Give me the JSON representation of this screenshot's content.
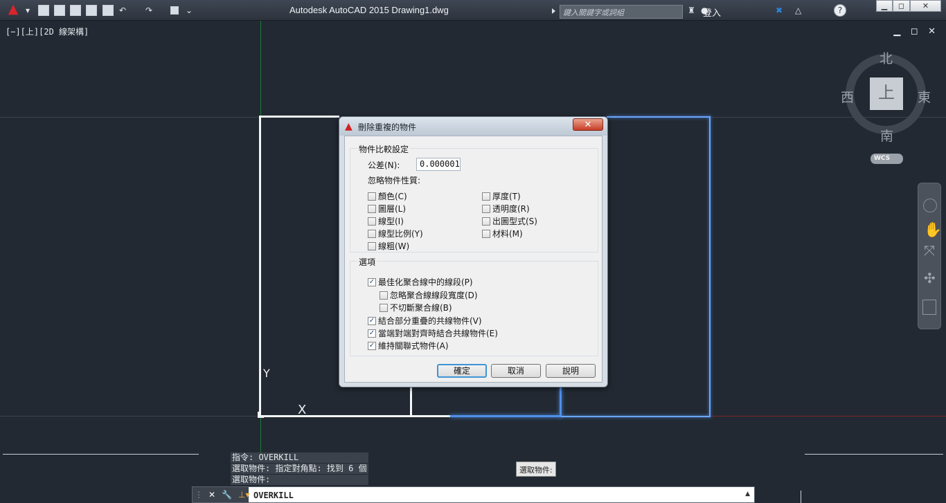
{
  "app": {
    "title": "Autodesk AutoCAD 2015    Drawing1.dwg",
    "search_placeholder": "鍵入關鍵字或詞組",
    "signin_label": "登入"
  },
  "viewport": {
    "label": "[−][上][2D 線架構]",
    "window_controls": "▁ ◻ ✕"
  },
  "viewcube": {
    "face_label": "上",
    "north": "北",
    "south": "南",
    "east": "東",
    "west": "西",
    "coordinate_system": "WCS"
  },
  "axes": {
    "y_label": "Y",
    "x_label": "X"
  },
  "dialog": {
    "title": "刪除重複的物件",
    "close_symbol": "✕",
    "comparison_group": "物件比較設定",
    "tolerance_label": "公差(N):",
    "tolerance_value": "0.000001",
    "ignore_label": "忽略物件性質:",
    "ignore_options": [
      {
        "label": "顏色(C)",
        "checked": false
      },
      {
        "label": "圖層(L)",
        "checked": false
      },
      {
        "label": "線型(I)",
        "checked": false
      },
      {
        "label": "線型比例(Y)",
        "checked": false
      },
      {
        "label": "線粗(W)",
        "checked": false
      },
      {
        "label": "厚度(T)",
        "checked": false
      },
      {
        "label": "透明度(R)",
        "checked": false
      },
      {
        "label": "出圖型式(S)",
        "checked": false
      },
      {
        "label": "材料(M)",
        "checked": false
      }
    ],
    "options_group": "選項",
    "options": [
      {
        "label": "最佳化聚合線中的線段(P)",
        "checked": true
      },
      {
        "label": "忽略聚合線線段寬度(D)",
        "checked": false
      },
      {
        "label": "不切斷聚合線(B)",
        "checked": false
      },
      {
        "label": "結合部分重疊的共線物件(V)",
        "checked": true
      },
      {
        "label": "當端對端對齊時結合共線物件(E)",
        "checked": true
      },
      {
        "label": "維持關聯式物件(A)",
        "checked": true
      }
    ],
    "buttons": {
      "ok": "確定",
      "cancel": "取消",
      "help": "說明"
    }
  },
  "command": {
    "history": [
      "指令: OVERKILL",
      "選取物件: 指定對角點: 找到 6 個",
      "選取物件:"
    ],
    "tooltip": "選取物件:",
    "current": "OVERKILL"
  },
  "colors": {
    "background": "#222932",
    "accent": "#3d95d5",
    "selection_blue": "#4f8fe8",
    "autocad_red": "#d8252b"
  }
}
